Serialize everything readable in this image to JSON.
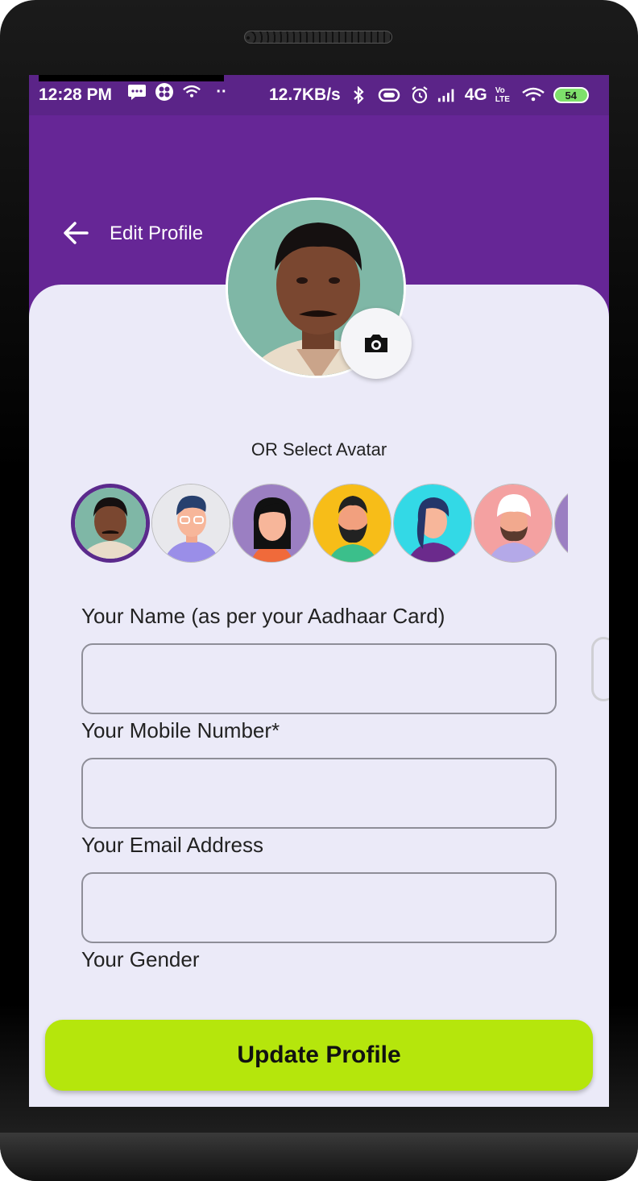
{
  "status_bar": {
    "time": "12:28 PM",
    "net_speed": "12.7KB/s",
    "network": "4G",
    "volte": "Vo LTE",
    "battery": "54",
    "icons": [
      "message-icon",
      "app-icon",
      "wifi-icon",
      "bluetooth-icon",
      "vibrate-icon",
      "alarm-icon",
      "signal-icon",
      "wifi-icon"
    ]
  },
  "header": {
    "title": "Edit Profile",
    "back_icon": "arrow-left-icon",
    "color": "#662696"
  },
  "profile": {
    "camera_icon": "camera-icon"
  },
  "avatar_section": {
    "label": "OR Select Avatar",
    "avatars": [
      "user-photo",
      "man-glasses",
      "woman-black-hair",
      "man-beard",
      "woman-blue",
      "man-turban",
      "partial-avatar"
    ],
    "selected_index": 0
  },
  "form": {
    "name_label": "Your Name (as per your Aadhaar Card)",
    "name_value": "",
    "mobile_label": "Your Mobile Number*",
    "mobile_value": "",
    "email_label": "Your Email Address",
    "email_value": "",
    "gender_label": "Your Gender"
  },
  "actions": {
    "update_label": "Update Profile",
    "update_color": "#b5e60c"
  }
}
